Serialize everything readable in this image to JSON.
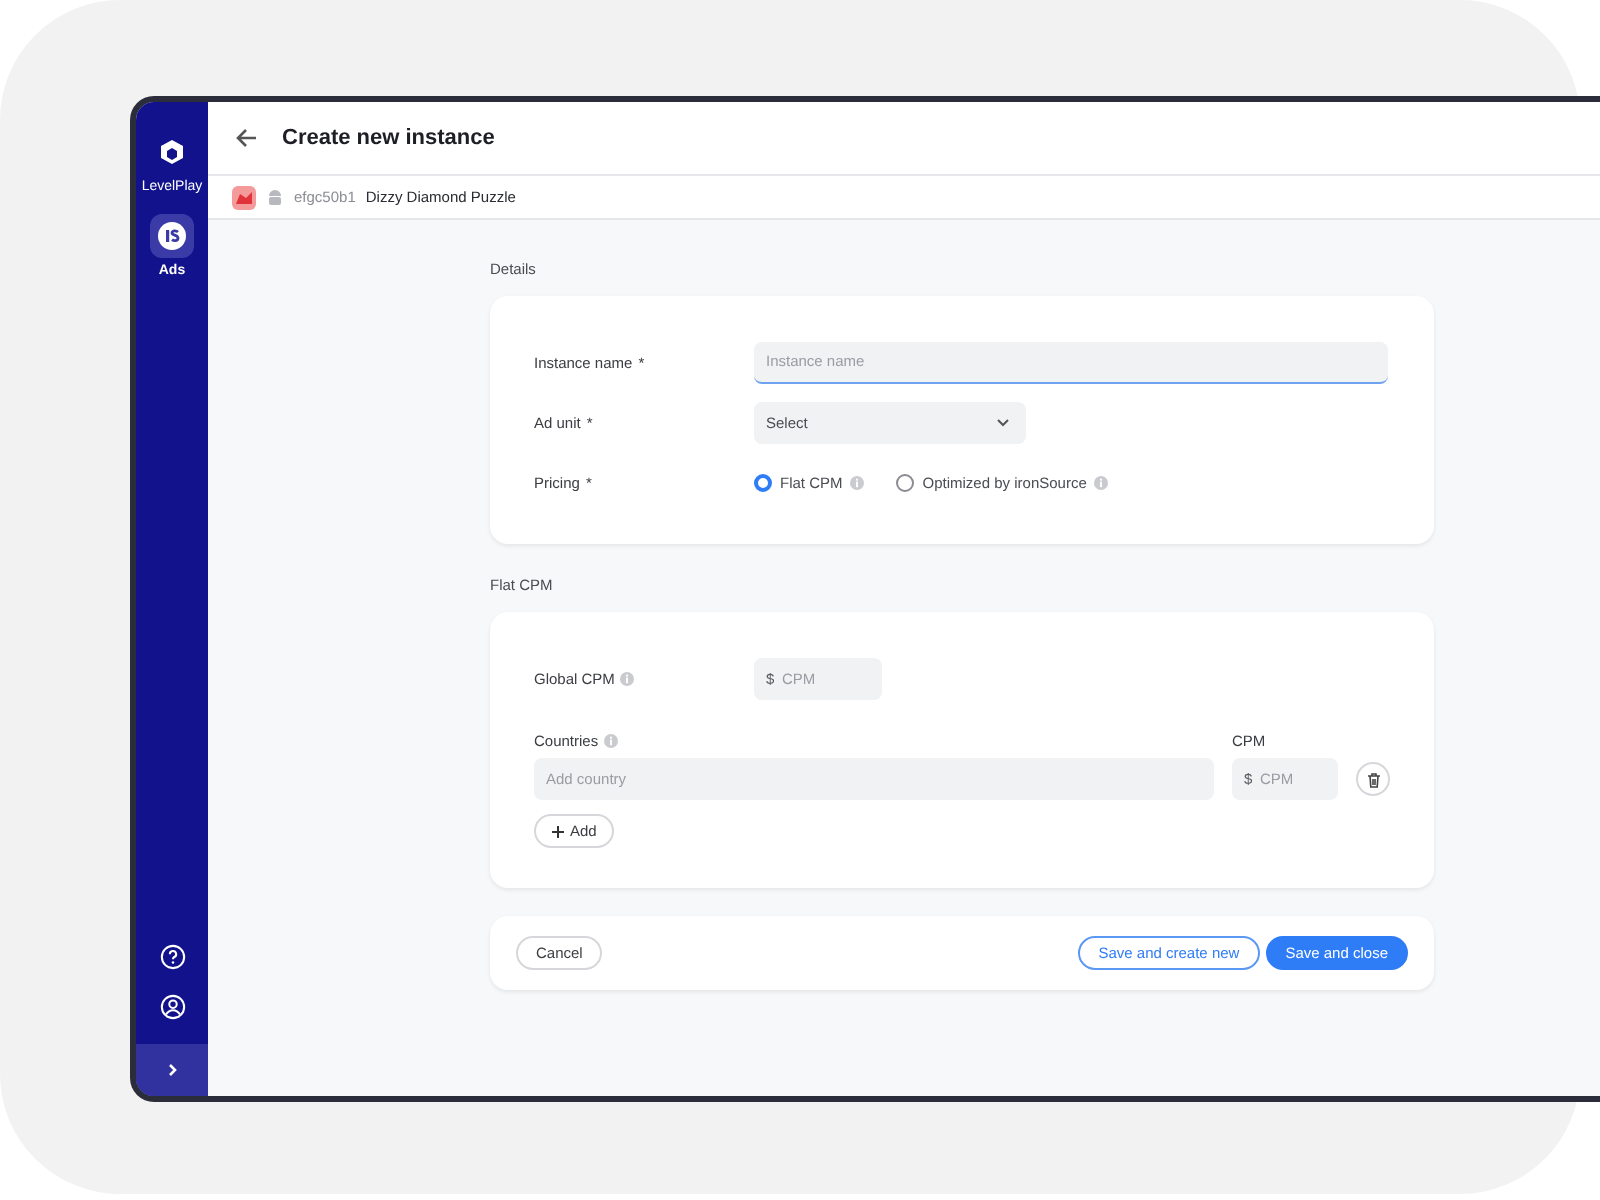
{
  "sidebar": {
    "items": [
      {
        "label": "LevelPlay",
        "selected": false,
        "kind": "logo"
      },
      {
        "label": "Ads",
        "selected": true,
        "kind": "app"
      }
    ]
  },
  "header": {
    "title": "Create new instance"
  },
  "breadcrumb": {
    "app_id": "efgc50b1",
    "app_name": "Dizzy Diamond Puzzle"
  },
  "details": {
    "heading": "Details",
    "instance_name": {
      "label": "Instance name",
      "required_mark": "*",
      "placeholder": "Instance name",
      "focused": true
    },
    "ad_unit": {
      "label": "Ad unit",
      "required_mark": "*",
      "value": "Select"
    },
    "pricing": {
      "label": "Pricing",
      "required_mark": "*",
      "options": [
        {
          "label": "Flat CPM",
          "selected": true
        },
        {
          "label": "Optimized by ironSource",
          "selected": false
        }
      ]
    }
  },
  "flat_cpm": {
    "heading": "Flat CPM",
    "global_cpm": {
      "label": "Global CPM",
      "currency": "$",
      "placeholder": "CPM"
    },
    "countries": {
      "label": "Countries",
      "placeholder": "Add country"
    },
    "cpm": {
      "label": "CPM",
      "currency": "$",
      "placeholder": "CPM"
    },
    "add_button": "Add"
  },
  "footer": {
    "cancel": "Cancel",
    "save_new": "Save and create new",
    "save_close": "Save and close"
  }
}
